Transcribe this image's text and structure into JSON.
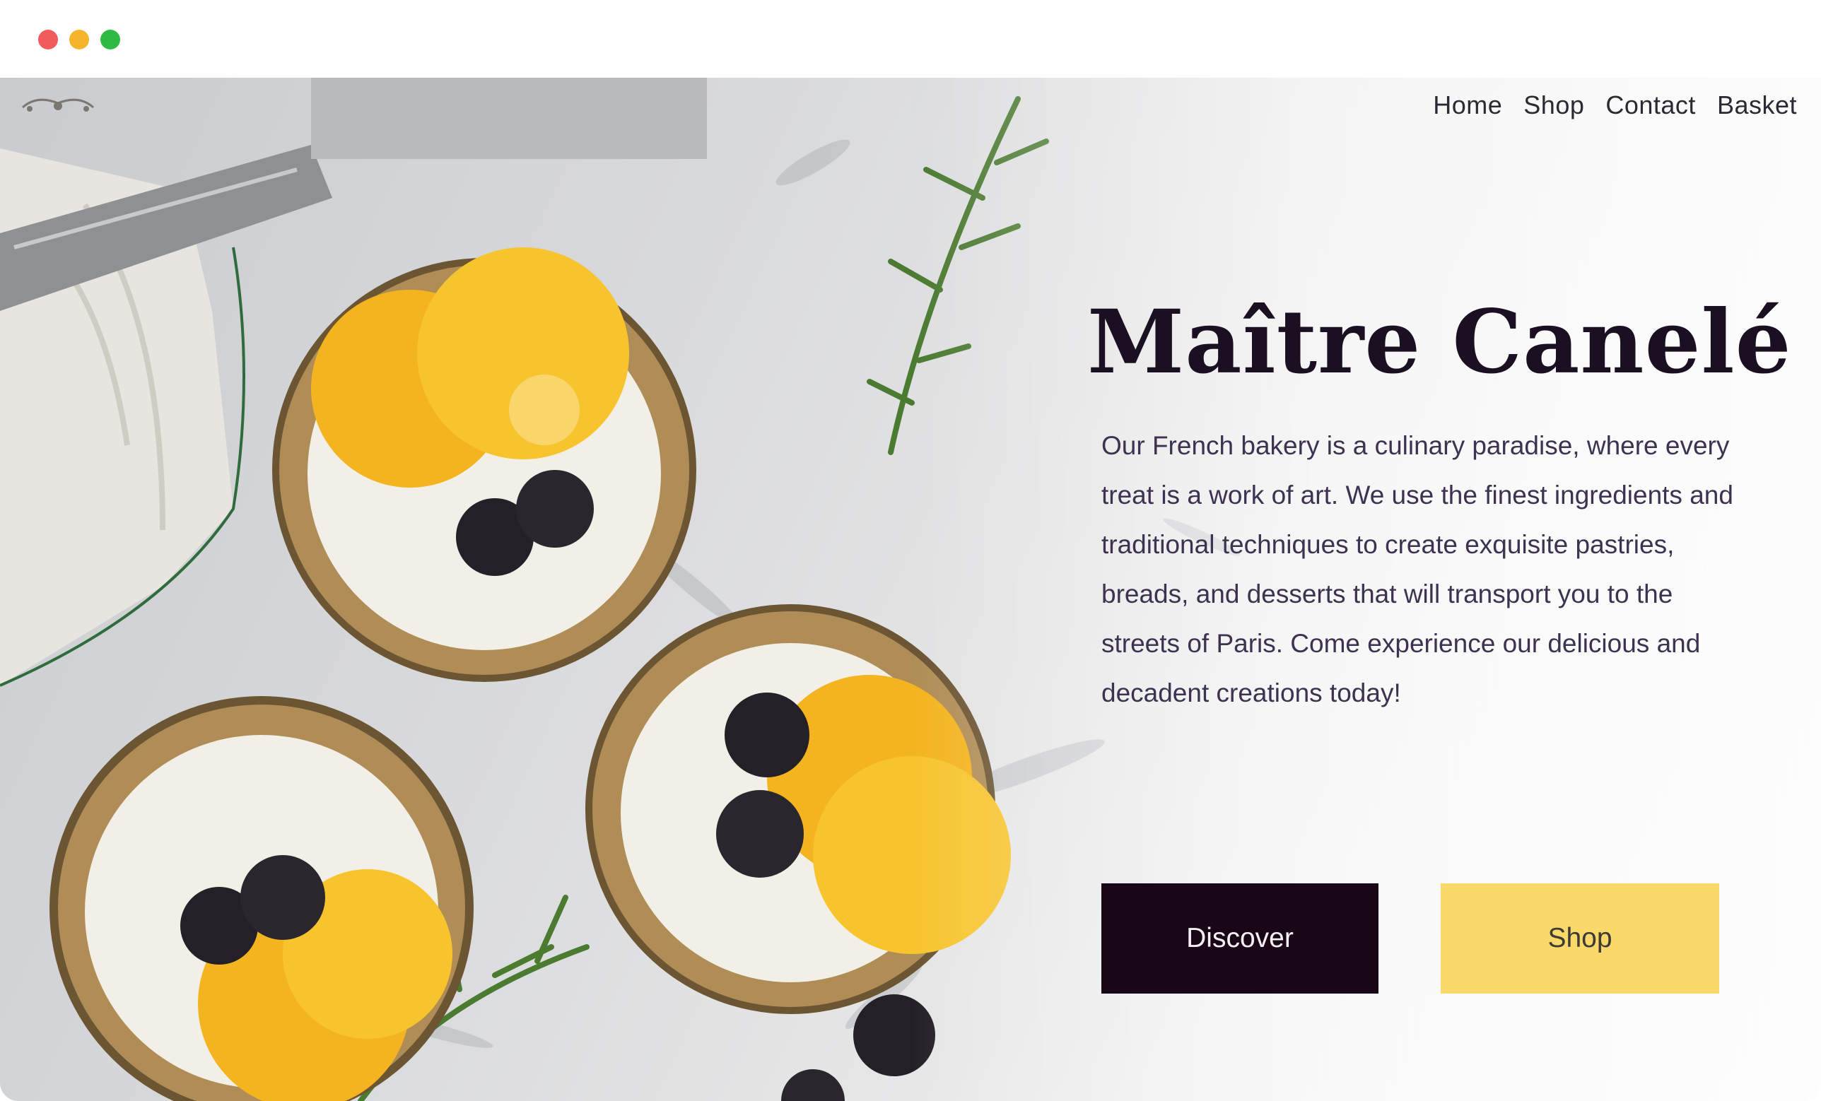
{
  "window": {
    "controls": [
      "close",
      "minimize",
      "maximize"
    ]
  },
  "nav": {
    "items": [
      "Home",
      "Shop",
      "Contact",
      "Basket"
    ]
  },
  "hero": {
    "title": "Maître Canelé",
    "description": "Our French bakery is a culinary paradise, where every treat is a work of art. We use the finest ingredients and traditional techniques to create exquisite pastries, breads, and desserts that will transport you to the streets of Paris. Come experience our delicious and decadent creations today!",
    "discover_label": "Discover",
    "shop_label": "Shop"
  },
  "colors": {
    "discover_bg": "#190617",
    "shop_bg": "#f8d96a",
    "title": "#1b0f22"
  }
}
